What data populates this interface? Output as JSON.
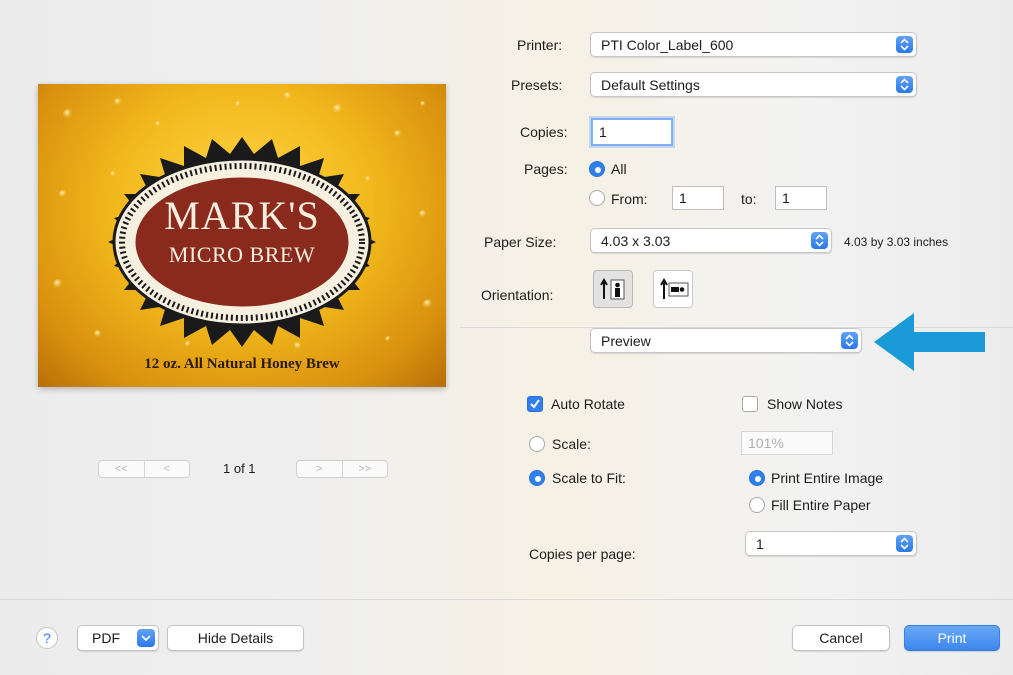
{
  "printer": {
    "label": "Printer:",
    "value": "PTI Color_Label_600"
  },
  "presets": {
    "label": "Presets:",
    "value": "Default Settings"
  },
  "copies": {
    "label": "Copies:",
    "value": "1"
  },
  "pages": {
    "label": "Pages:",
    "all_label": "All",
    "from_label": "From:",
    "from_value": "1",
    "to_label": "to:",
    "to_value": "1",
    "selected": "All"
  },
  "paper_size": {
    "label": "Paper Size:",
    "value": "4.03 x 3.03",
    "note": "4.03 by 3.03 inches"
  },
  "orientation": {
    "label": "Orientation:",
    "selected": "portrait"
  },
  "section_popup": {
    "value": "Preview"
  },
  "auto_rotate": {
    "label": "Auto Rotate",
    "checked": true
  },
  "show_notes": {
    "label": "Show Notes",
    "checked": false
  },
  "scale": {
    "label": "Scale:",
    "value": "101%"
  },
  "scale_to_fit": {
    "label": "Scale to Fit:",
    "selected": true
  },
  "fit_options": {
    "print_entire": "Print Entire Image",
    "fill_entire": "Fill Entire Paper",
    "selected": "Print Entire Image"
  },
  "copies_per_page": {
    "label": "Copies per page:",
    "value": "1"
  },
  "preview": {
    "title_line1": "MARK'S",
    "title_line2": "MICRO BREW",
    "tagline": "12 oz. All Natural Honey Brew",
    "page_indicator": "1 of 1",
    "nav_first": "<<",
    "nav_prev": "<",
    "nav_next": ">",
    "nav_last": ">>"
  },
  "footer": {
    "help": "?",
    "pdf": "PDF",
    "hide_details": "Hide Details",
    "cancel": "Cancel",
    "print": "Print"
  },
  "colors": {
    "accent": "#2f80ed",
    "arrow": "#1a9ad6",
    "label_red": "#8a2a1c",
    "gold": "#f2b81c"
  }
}
